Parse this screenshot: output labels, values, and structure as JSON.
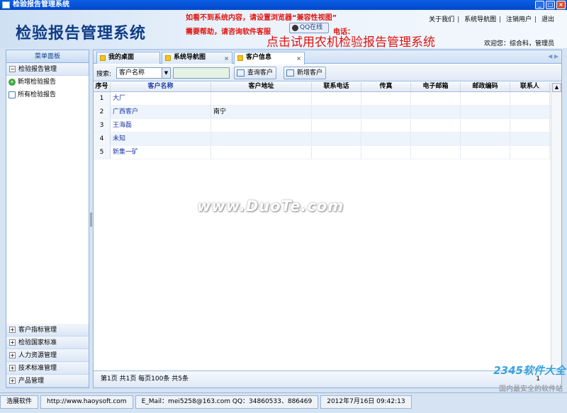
{
  "window": {
    "title": "检验报告管理系统"
  },
  "header": {
    "app_title": "检验报告管理系统",
    "notice1": "如看不到系统内容，请设置浏览器“兼容性视图”",
    "notice2": "需要帮助，请咨询软件客服",
    "qq_label": "QQ在线",
    "phone_label": "电话：",
    "promo": "点击试用农机检验报告管理系统",
    "links": [
      "关于我们",
      "系统导航图",
      "注销用户",
      "退出"
    ],
    "welcome": "欢迎您：综合科，管理员"
  },
  "sidebar": {
    "title": "菜单面板",
    "top_group": "检验报告管理",
    "items": [
      "新增检验报告",
      "所有检验报告"
    ],
    "bottom_groups": [
      "客户指标管理",
      "检验国家标准",
      "人力资源管理",
      "技术标准管理",
      "产品管理"
    ]
  },
  "tabs": [
    {
      "label": "我的桌面"
    },
    {
      "label": "系统导航图"
    },
    {
      "label": "客户信息"
    }
  ],
  "toolbar": {
    "search_label": "搜索:",
    "search_field": "客户名称",
    "query_button": "查询客户",
    "add_button": "新增客户"
  },
  "table": {
    "columns": [
      "序号",
      "客户名称",
      "客户地址",
      "联系电话",
      "传真",
      "电子邮箱",
      "邮政编码",
      "联系人"
    ],
    "rows": [
      {
        "no": "1",
        "name": "大厂",
        "address": ""
      },
      {
        "no": "2",
        "name": "广西客户",
        "address": "南宁"
      },
      {
        "no": "3",
        "name": "王海磊",
        "address": ""
      },
      {
        "no": "4",
        "name": "未知",
        "address": ""
      },
      {
        "no": "5",
        "name": "新集一矿",
        "address": ""
      }
    ]
  },
  "pager": {
    "summary": "第1页 共1页 每页100条 共5条",
    "right": "1"
  },
  "watermark": "www.DuoTe.com",
  "statusbar": {
    "company": "浩展软件",
    "site": "http://www.haoysoft.com",
    "contact": "E_Mail：mei5258@163.com  QQ：34860533、886469",
    "datetime": "2012年7月16日  09:42:13"
  },
  "badge": {
    "big": "2345软件大全",
    "small": "国内最安全的软件站"
  }
}
